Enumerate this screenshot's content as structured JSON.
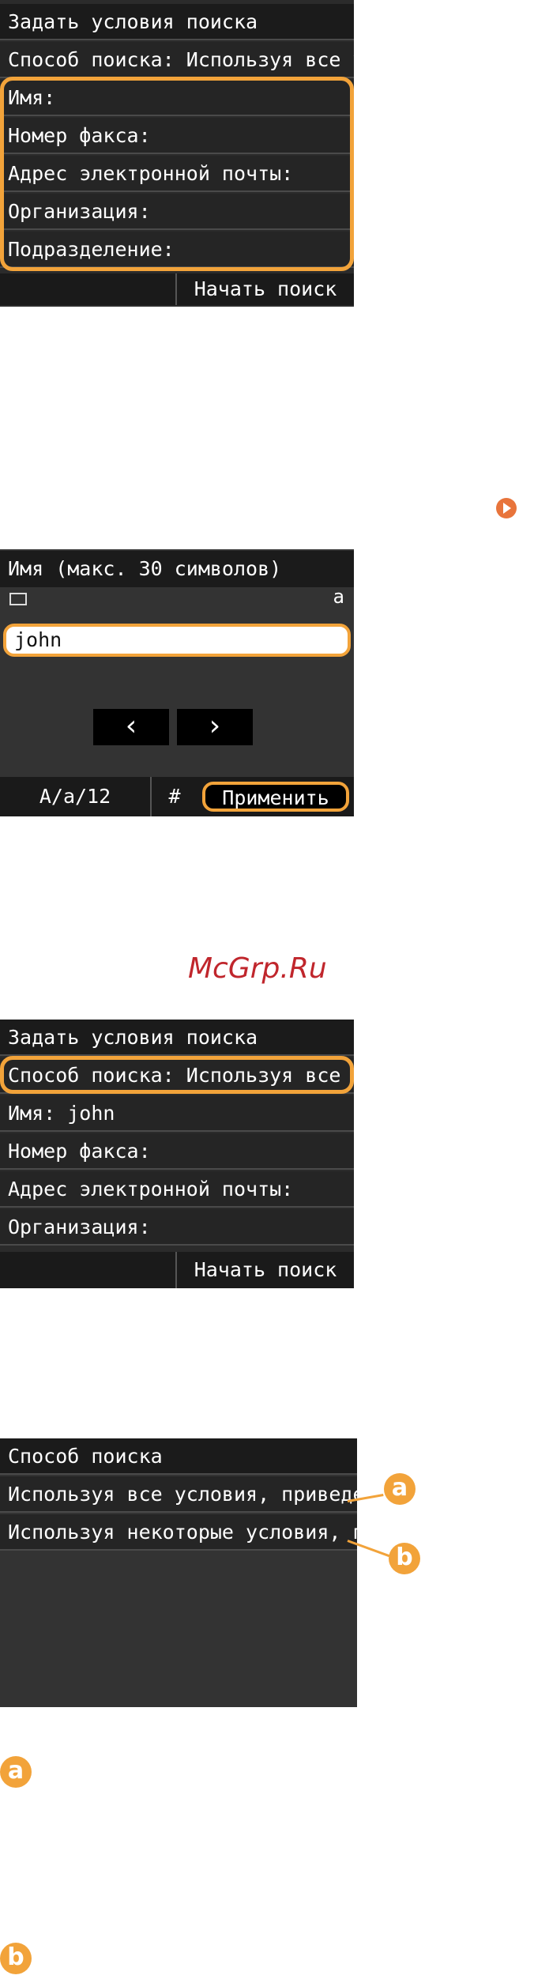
{
  "screen1": {
    "title": "Задать условия поиска",
    "rows": [
      "Способ поиска: Используя все у",
      "Имя:",
      "Номер факса:",
      "Адрес электронной почты:",
      "Организация:",
      "Подразделение:"
    ],
    "start_search": "Начать поиск"
  },
  "screen2": {
    "title": "Имя (макс. 30 символов)",
    "mode_indicator": "a",
    "input_value": "john",
    "prev_arrow": "‹",
    "next_arrow": "›",
    "input_mode": "A/a/12",
    "symbol_key": "#",
    "apply": "Применить"
  },
  "watermark": "McGrp.Ru",
  "screen3": {
    "title": "Задать условия поиска",
    "rows": [
      "Способ поиска: Используя все у",
      "Имя: john",
      "Номер факса:",
      "Адрес электронной почты:",
      "Организация:"
    ],
    "start_search": "Начать поиск"
  },
  "screen4": {
    "title": "Способ поиска",
    "rows": [
      "Используя все условия, приведе",
      "Используя некоторые условия, п"
    ]
  },
  "callouts": {
    "a": "a",
    "b": "b"
  },
  "colors": {
    "accent": "#f2a33a",
    "screen_bg": "#2b2b2b",
    "watermark": "#c0262c"
  }
}
